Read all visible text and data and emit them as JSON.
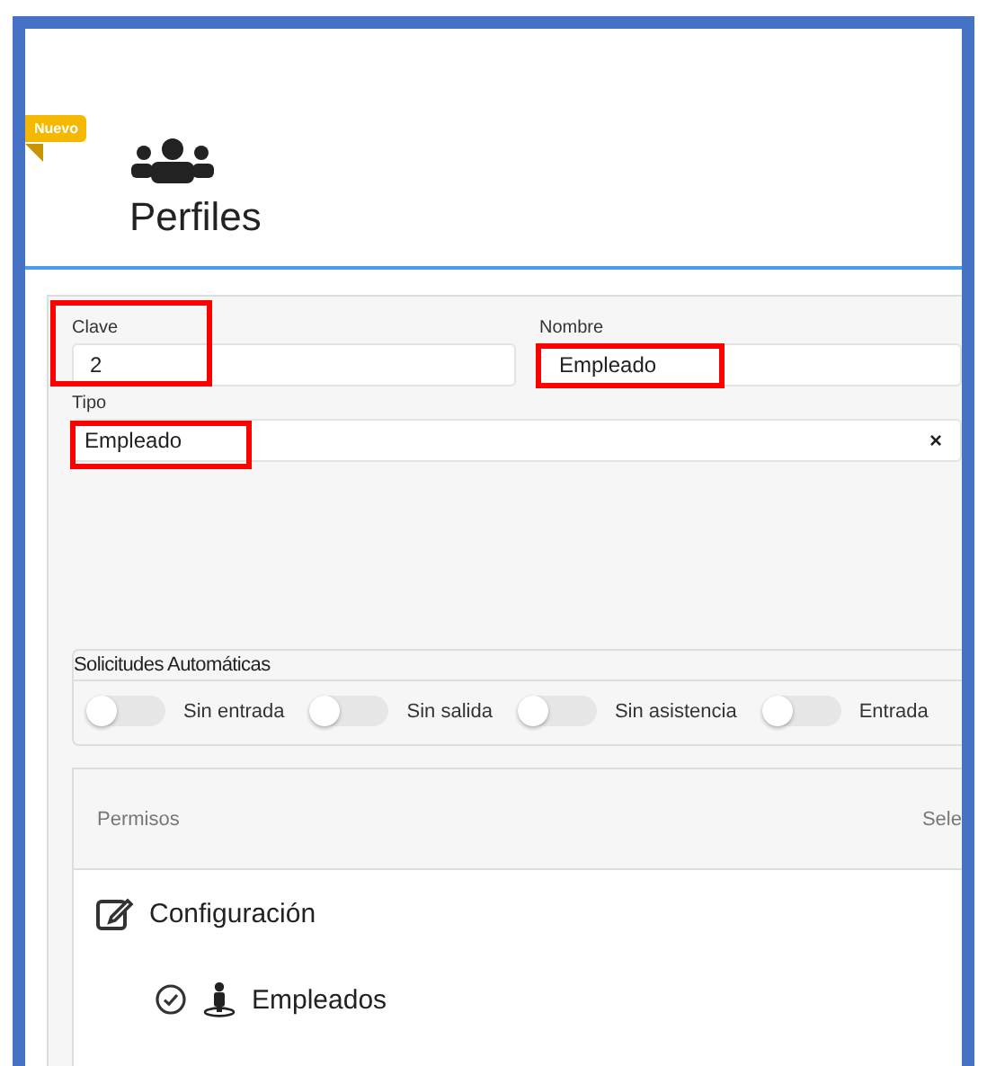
{
  "header": {
    "badge": "Nuevo",
    "title": "Perfiles"
  },
  "form": {
    "fields": [
      {
        "label": "Clave",
        "value": "2",
        "highlighted": true,
        "kind": "label"
      },
      {
        "label": "Nombre",
        "value": "Empleado",
        "highlighted": true,
        "kind": "value"
      }
    ],
    "tipo": {
      "label": "Tipo",
      "value": "Empleado",
      "highlighted": true,
      "clear": "×"
    }
  },
  "auto_requests": {
    "title": "Solicitudes Automáticas",
    "toggles": [
      {
        "label": "Sin entrada",
        "on": false
      },
      {
        "label": "Sin salida",
        "on": false
      },
      {
        "label": "Sin asistencia",
        "on": false
      },
      {
        "label": "Entrada",
        "on": false
      }
    ]
  },
  "permissions": {
    "header": "Permisos",
    "header_right": "Sele",
    "items": [
      {
        "kind": "section",
        "label": "Configuración"
      },
      {
        "kind": "module",
        "label": "Empleados",
        "checked": true
      }
    ]
  }
}
